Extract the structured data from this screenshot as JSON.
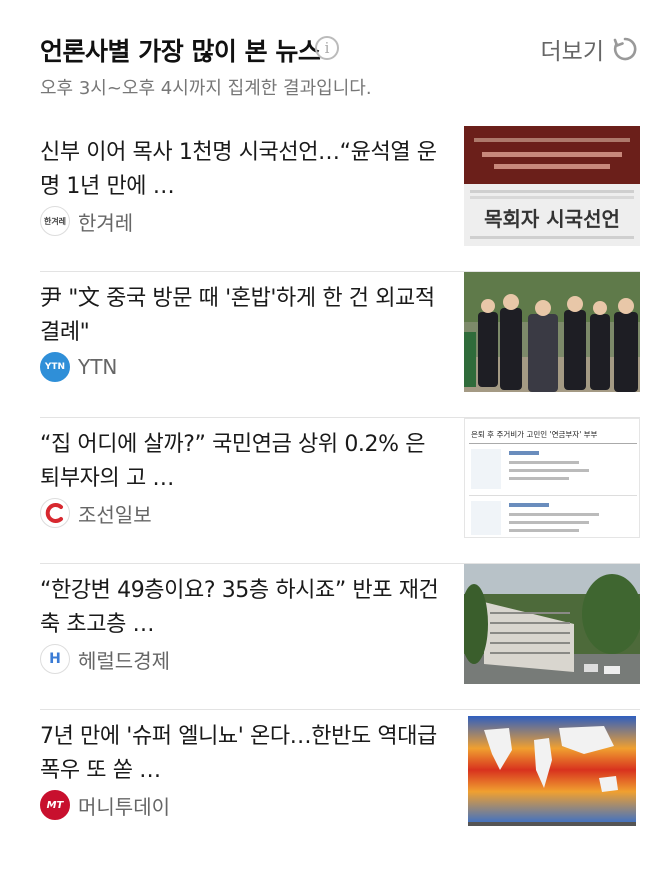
{
  "header": {
    "title": "언론사별 가장 많이 본 뉴스",
    "info_icon": "info-icon",
    "more_label": "더보기",
    "refresh_icon": "refresh-icon",
    "subtitle": "오후 3시~오후 4시까지 집계한 결과입니다."
  },
  "news": [
    {
      "headline": "신부 이어 목사 1천명 시국선언…“윤석열 운명 1년 만에 …",
      "source": "한겨레",
      "logo_text": "한겨레",
      "thumb_text": "목회자 시국선언"
    },
    {
      "headline": "尹 \"文 중국 방문 때 '혼밥'하게 한 건 외교적 결례\"",
      "source": "YTN",
      "logo_text": "YTN"
    },
    {
      "headline": "“집 어디에 살까?” 국민연금 상위 0.2% 은퇴부자의 고 …",
      "source": "조선일보",
      "logo_text": "",
      "thumb_text": "은퇴 후 주거비가 고민인 '연금부자' 부부"
    },
    {
      "headline": "“한강변 49층이요? 35층 하시죠” 반포 재건축 초고층 …",
      "source": "헤럴드경제",
      "logo_text": "H"
    },
    {
      "headline": "7년 만에 '슈퍼 엘니뇨' 온다…한반도 역대급 폭우 또 쏟 …",
      "source": "머니투데이",
      "logo_text": "MT"
    }
  ],
  "colors": {
    "ytn_blue": "#2f8fd8",
    "chosun_red": "#d7282f",
    "mt_red": "#c8102e",
    "herald_blue": "#3a7bd5"
  }
}
